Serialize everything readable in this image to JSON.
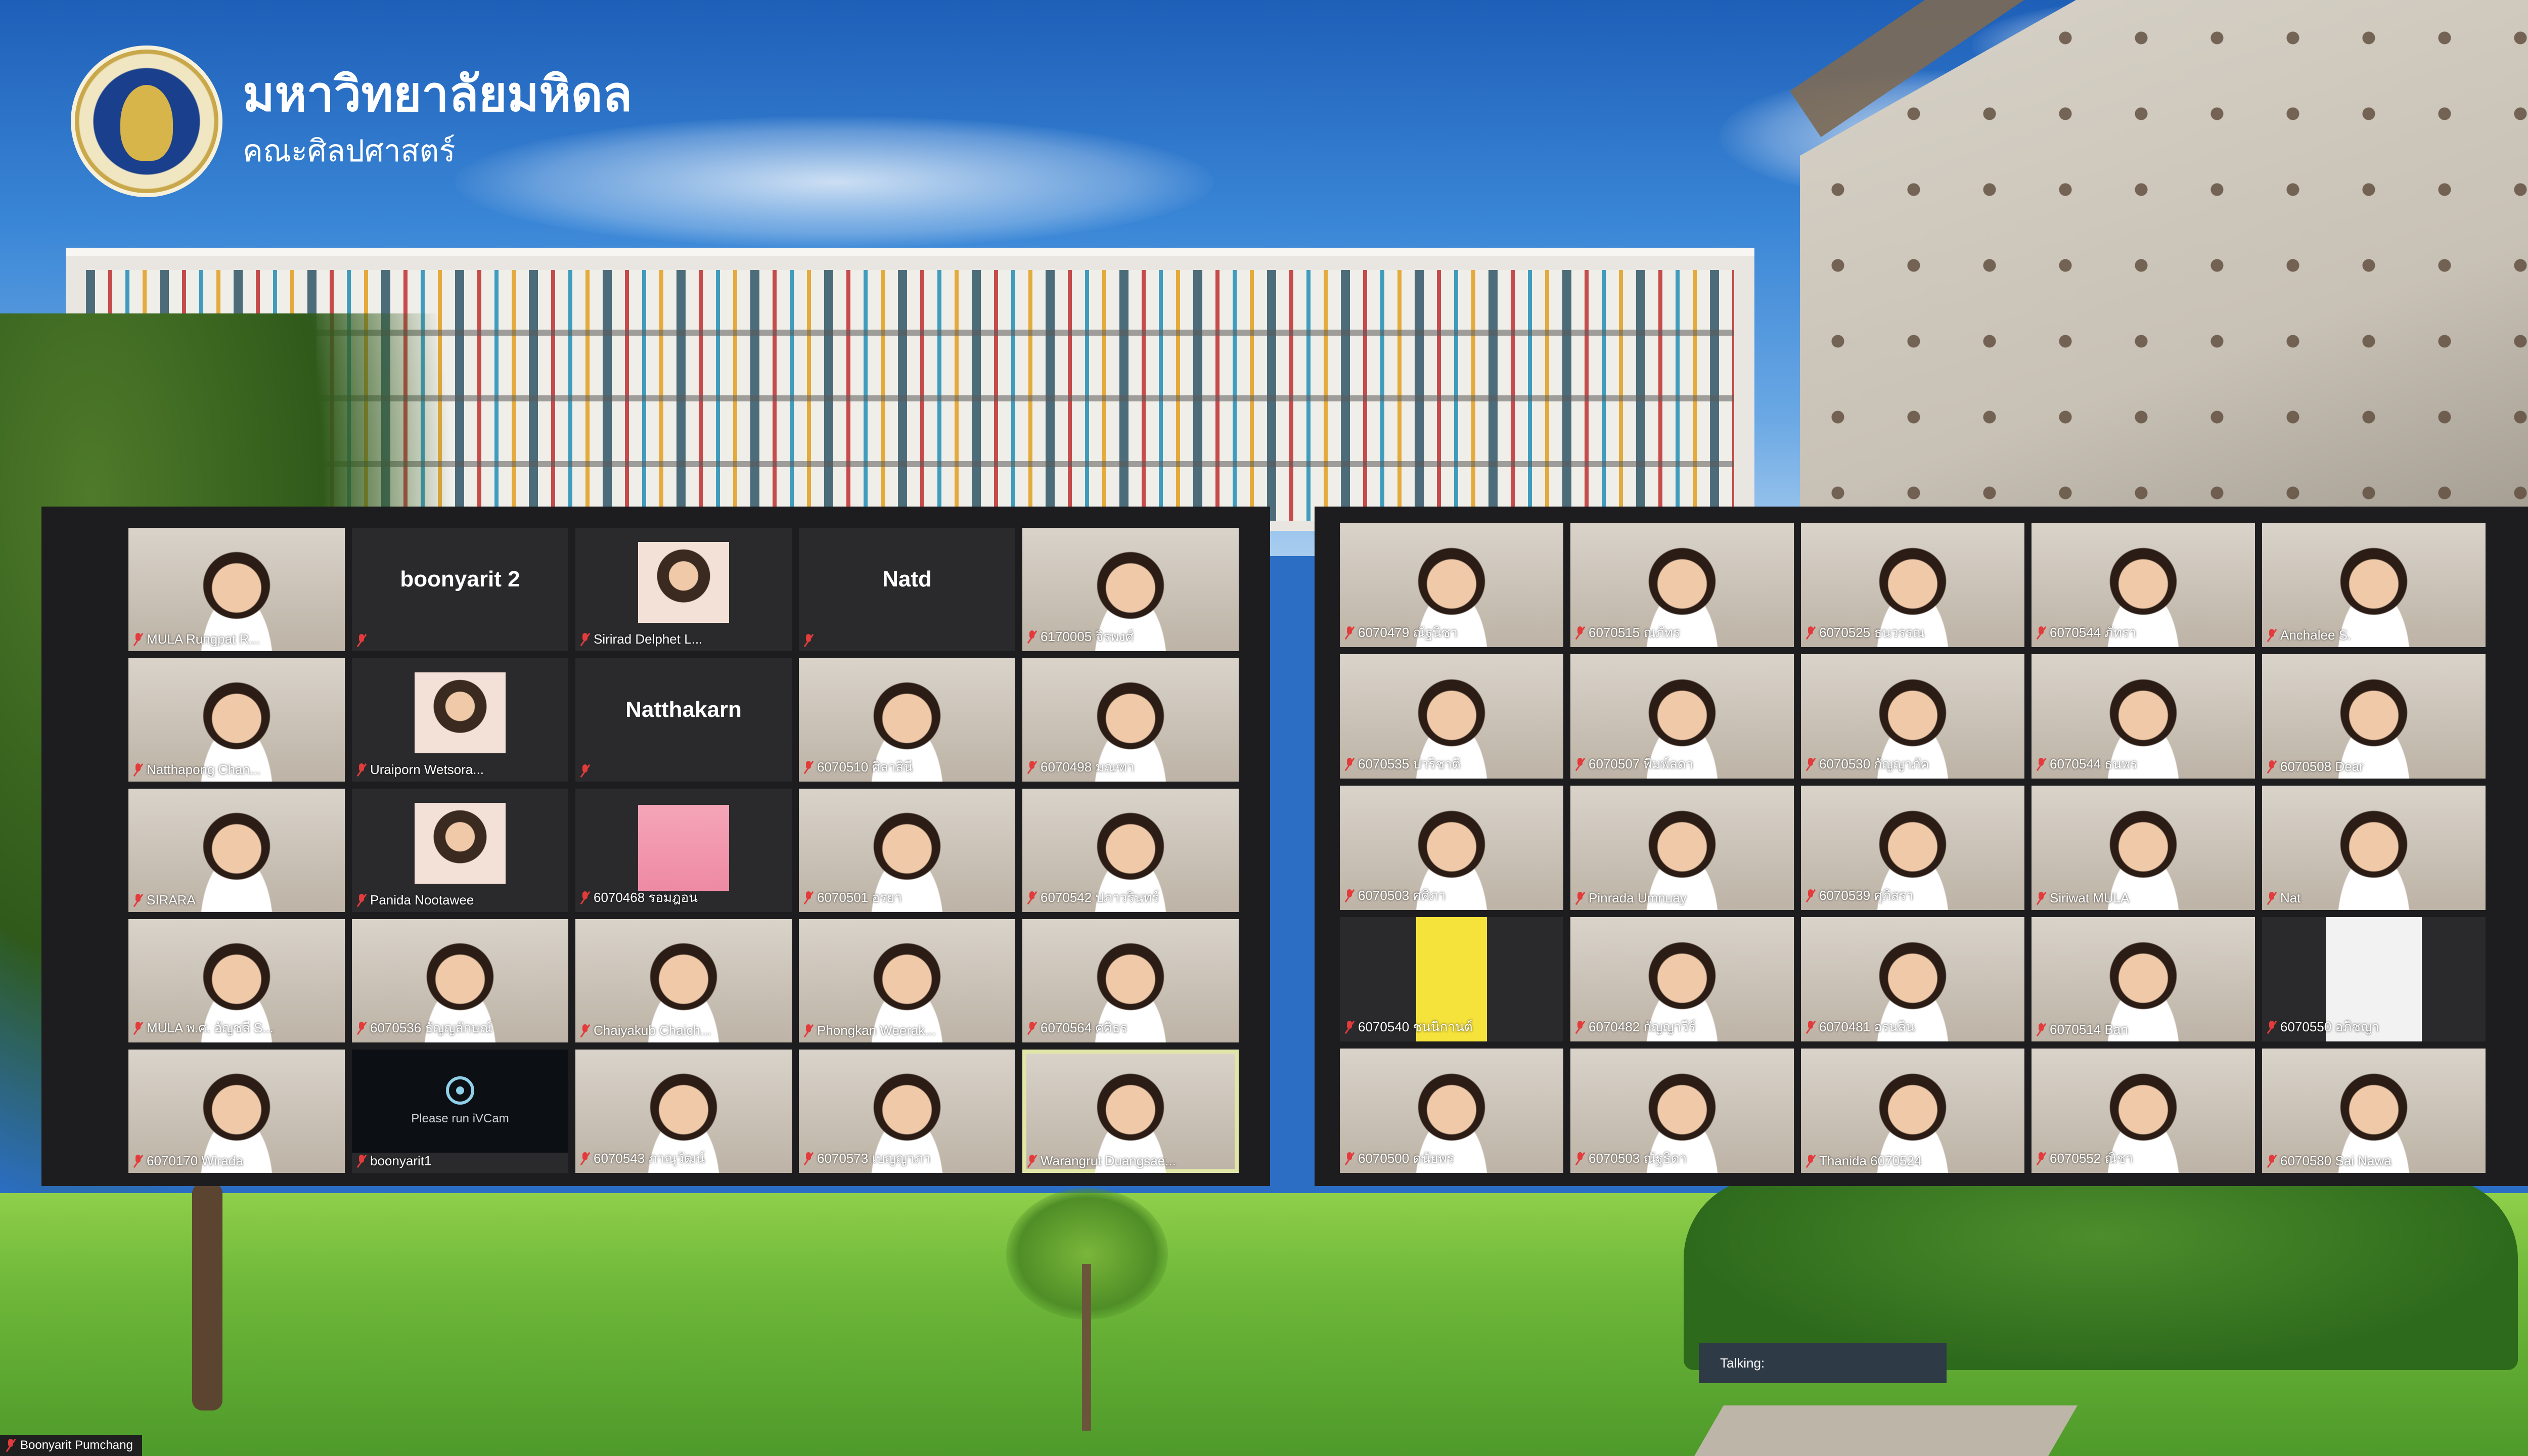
{
  "logo": {
    "title": "มหาวิทยาลัยมหิดล",
    "subtitle": "คณะศิลปศาสตร์"
  },
  "left_gallery": [
    {
      "label": "MULA Rungpat R...",
      "kind": "video"
    },
    {
      "label": "",
      "kind": "name",
      "display_name": "boonyarit 2"
    },
    {
      "label": "Sirirad Delphet L...",
      "kind": "avatar"
    },
    {
      "label": "",
      "kind": "name",
      "display_name": "Natd"
    },
    {
      "label": "6170005 จิรพงศ์",
      "kind": "video"
    },
    {
      "label": "Natthapong Chan...",
      "kind": "video"
    },
    {
      "label": "Uraiporn Wetsora...",
      "kind": "avatar"
    },
    {
      "label": "",
      "kind": "name",
      "display_name": "Natthakarn"
    },
    {
      "label": "6070510 ศิลาสินี",
      "kind": "video"
    },
    {
      "label": "6070498 มณฑา",
      "kind": "video"
    },
    {
      "label": "SIRARA",
      "kind": "video"
    },
    {
      "label": "Panida Nootawee",
      "kind": "avatar"
    },
    {
      "label": "6070468 รอมฎอน",
      "kind": "pink"
    },
    {
      "label": "6070501 อรยา",
      "kind": "video"
    },
    {
      "label": "6070542 ปภาวรินทร์",
      "kind": "video"
    },
    {
      "label": "MULA พ.ศ. อัญชลี S...",
      "kind": "video"
    },
    {
      "label": "6070536 ธัญญลักษณ์",
      "kind": "video"
    },
    {
      "label": "Chaiyakub Chaich...",
      "kind": "video"
    },
    {
      "label": "Phongkan Weerak...",
      "kind": "video"
    },
    {
      "label": "6070564 ศศิธร",
      "kind": "video"
    },
    {
      "label": "6070170 Wirada",
      "kind": "video"
    },
    {
      "label": "boonyarit1",
      "kind": "ivcam",
      "message": "Please run iVCam"
    },
    {
      "label": "6070543 ภาณุวัฒน์",
      "kind": "video"
    },
    {
      "label": "6070573 เบญญาภา",
      "kind": "video"
    },
    {
      "label": "Warangrut Duangsae...",
      "kind": "video",
      "active": true
    }
  ],
  "right_gallery": [
    {
      "label": "6070479 ณัฐนิชา",
      "kind": "video"
    },
    {
      "label": "6070515 ณภัทร",
      "kind": "video"
    },
    {
      "label": "6070525 ธนวรรณ",
      "kind": "video"
    },
    {
      "label": "6070544 ภัทรา",
      "kind": "video"
    },
    {
      "label": "Anchalee S.",
      "kind": "video"
    },
    {
      "label": "6070535 ปาริชาติ",
      "kind": "video"
    },
    {
      "label": "6070507 พิมพ์ลดา",
      "kind": "video"
    },
    {
      "label": "6070530 กัญญาภัค",
      "kind": "video"
    },
    {
      "label": "6070544 ธนพร",
      "kind": "video"
    },
    {
      "label": "6070508 Dear",
      "kind": "video"
    },
    {
      "label": "6070503 ศศิภา",
      "kind": "video"
    },
    {
      "label": "Pinrada Umnuay",
      "kind": "video"
    },
    {
      "label": "6070539 ศุภิสรา",
      "kind": "video"
    },
    {
      "label": "Siriwat MULA",
      "kind": "video"
    },
    {
      "label": "Nat",
      "kind": "video"
    },
    {
      "label": "6070540 ชนนิกานต์",
      "kind": "yellow"
    },
    {
      "label": "6070482 กัญญาวีร์",
      "kind": "video"
    },
    {
      "label": "6070481 อรนลิน",
      "kind": "video"
    },
    {
      "label": "6070514 Ban",
      "kind": "video"
    },
    {
      "label": "6070550 อภิชญา",
      "kind": "white"
    },
    {
      "label": "6070500 ดนัยพร",
      "kind": "video"
    },
    {
      "label": "6070503 ณัฐธิดา",
      "kind": "video"
    },
    {
      "label": "Thanida 6070524",
      "kind": "video"
    },
    {
      "label": "6070552 ณิชา",
      "kind": "video"
    },
    {
      "label": "6070580 Sai Nawa",
      "kind": "video"
    }
  ],
  "talking": {
    "label": "Talking:"
  },
  "self_view": {
    "name": "Boonyarit Pumchang"
  }
}
